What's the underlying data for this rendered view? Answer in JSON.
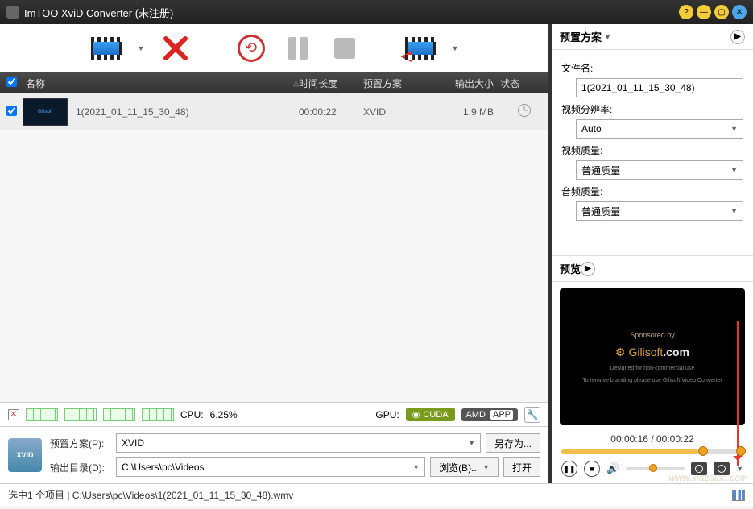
{
  "window": {
    "title": "ImTOO XviD Converter (未注册)"
  },
  "toolbar": {
    "add_dropdown": "▼",
    "import_dropdown": "▼"
  },
  "columns": {
    "name": "名称",
    "duration": "时间长度",
    "profile": "预置方案",
    "out_size": "输出大小",
    "status": "状态"
  },
  "items": [
    {
      "name": "1(2021_01_11_15_30_48)",
      "duration": "00:00:22",
      "profile": "XVID",
      "out_size": "1.9 MB"
    }
  ],
  "cpu": {
    "label": "CPU:",
    "value": "6.25%",
    "gpu_label": "GPU:",
    "cuda": "CUDA",
    "amd": "AMD",
    "app": "APP"
  },
  "dest": {
    "profile_label": "预置方案(P):",
    "profile_value": "XVID",
    "save_as": "另存为...",
    "output_label": "输出目录(D):",
    "output_value": "C:\\Users\\pc\\Videos",
    "browse": "浏览(B)...",
    "open": "打开"
  },
  "status": {
    "text": "选中1 个项目 | C:\\Users\\pc\\Videos\\1(2021_01_11_15_30_48).wmv"
  },
  "right": {
    "preset_header": "预置方案",
    "filename_label": "文件名:",
    "filename_value": "1(2021_01_11_15_30_48)",
    "res_label": "视频分辨率:",
    "res_value": "Auto",
    "vq_label": "视频质量:",
    "vq_value": "普通质量",
    "aq_label": "音频质量:",
    "aq_value": "普通质量",
    "preview_header": "预览",
    "preview_sponsored": "Sponsored by",
    "preview_brand": "Gilisoft",
    "preview_brand2": ".com",
    "preview_note1": "Designed for non-commercial use",
    "preview_note2": "To remove branding please use Gilisoft Video Converter",
    "time_cur": "00:00:16",
    "time_sep": " / ",
    "time_tot": "00:00:22"
  },
  "watermark": "www.xiazaiba.com"
}
